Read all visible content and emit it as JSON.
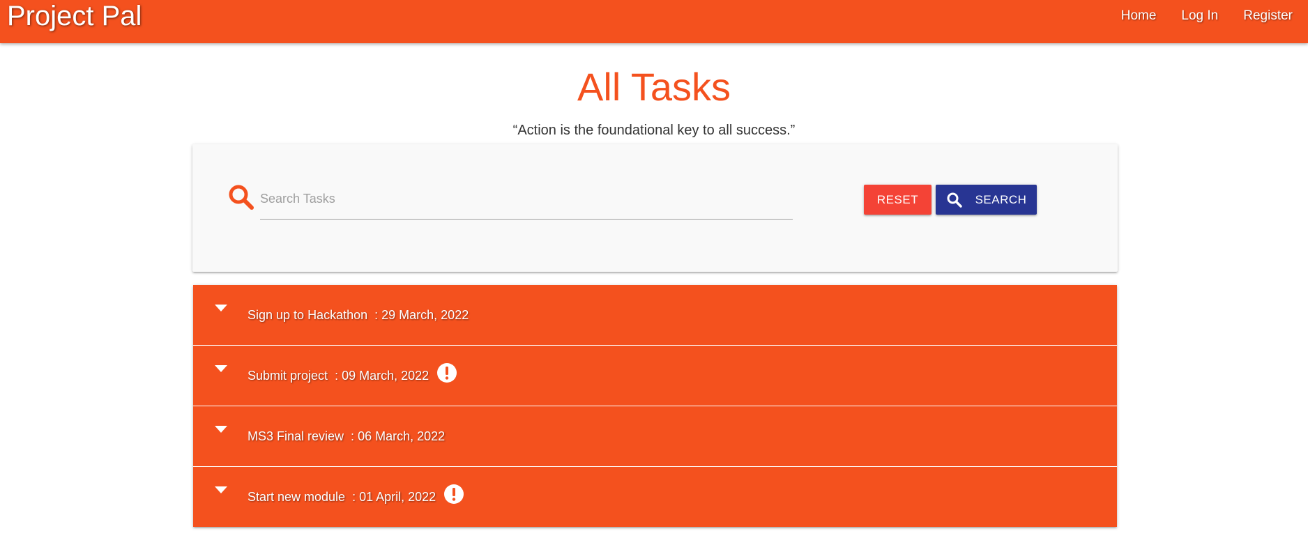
{
  "navbar": {
    "brand": "Project Pal",
    "links": [
      {
        "label": "Home"
      },
      {
        "label": "Log In"
      },
      {
        "label": "Register"
      }
    ]
  },
  "header": {
    "title": "All Tasks",
    "quote": "“Action is the foundational key to all success.”"
  },
  "search": {
    "placeholder": "Search Tasks",
    "value": "",
    "reset_label": "RESET",
    "search_label": "SEARCH"
  },
  "tasks": [
    {
      "name": "Sign up to Hackathon",
      "separator": "  : ",
      "date": "29 March, 2022",
      "urgent": false
    },
    {
      "name": "Submit project",
      "separator": "  : ",
      "date": "09 March, 2022",
      "urgent": true
    },
    {
      "name": "MS3 Final review",
      "separator": "  : ",
      "date": "06 March, 2022",
      "urgent": false
    },
    {
      "name": "Start new module",
      "separator": "  : ",
      "date": "01 April, 2022",
      "urgent": true
    }
  ],
  "icons": {
    "search": "search-icon",
    "caret": "caret-down-icon",
    "alert": "exclamation-circle-icon"
  },
  "colors": {
    "primary": "#f4511e",
    "reset_button": "#f44336",
    "search_button": "#283593",
    "card_background": "#f9f9f9"
  }
}
